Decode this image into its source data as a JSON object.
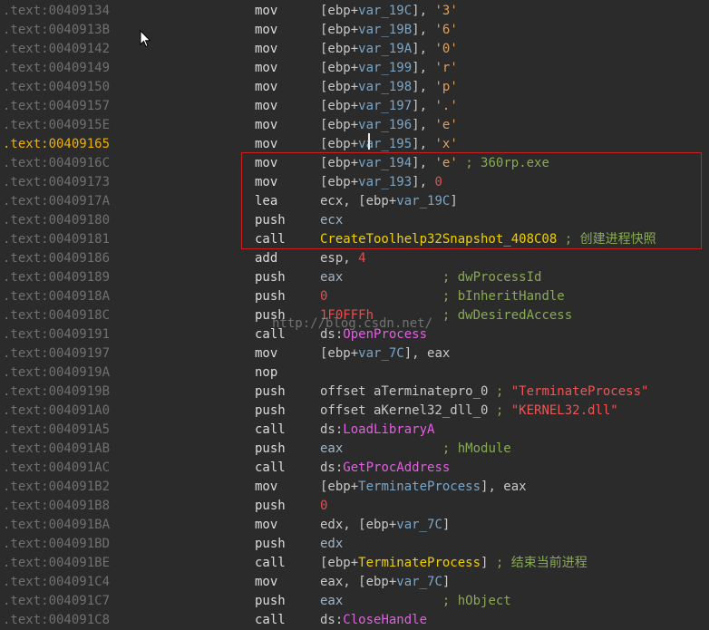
{
  "listing": {
    "rows": [
      {
        "addr": ".text:00409134",
        "hl": false,
        "mnem": "mov",
        "ops": [
          {
            "t": "[ebp+",
            "k": "plain"
          },
          {
            "t": "var_19C",
            "k": "var"
          },
          {
            "t": "], ",
            "k": "plain"
          },
          {
            "t": "'3'",
            "k": "str"
          }
        ]
      },
      {
        "addr": ".text:0040913B",
        "hl": false,
        "mnem": "mov",
        "ops": [
          {
            "t": "[ebp+",
            "k": "plain"
          },
          {
            "t": "var_19B",
            "k": "var"
          },
          {
            "t": "], ",
            "k": "plain"
          },
          {
            "t": "'6'",
            "k": "str"
          }
        ]
      },
      {
        "addr": ".text:00409142",
        "hl": false,
        "mnem": "mov",
        "ops": [
          {
            "t": "[ebp+",
            "k": "plain"
          },
          {
            "t": "var_19A",
            "k": "var"
          },
          {
            "t": "], ",
            "k": "plain"
          },
          {
            "t": "'0'",
            "k": "str"
          }
        ]
      },
      {
        "addr": ".text:00409149",
        "hl": false,
        "mnem": "mov",
        "ops": [
          {
            "t": "[ebp+",
            "k": "plain"
          },
          {
            "t": "var_199",
            "k": "var"
          },
          {
            "t": "], ",
            "k": "plain"
          },
          {
            "t": "'r'",
            "k": "str"
          }
        ]
      },
      {
        "addr": ".text:00409150",
        "hl": false,
        "mnem": "mov",
        "ops": [
          {
            "t": "[ebp+",
            "k": "plain"
          },
          {
            "t": "var_198",
            "k": "var"
          },
          {
            "t": "], ",
            "k": "plain"
          },
          {
            "t": "'p'",
            "k": "str"
          }
        ]
      },
      {
        "addr": ".text:00409157",
        "hl": false,
        "mnem": "mov",
        "ops": [
          {
            "t": "[ebp+",
            "k": "plain"
          },
          {
            "t": "var_197",
            "k": "var"
          },
          {
            "t": "], ",
            "k": "plain"
          },
          {
            "t": "'.'",
            "k": "str"
          }
        ]
      },
      {
        "addr": ".text:0040915E",
        "hl": false,
        "mnem": "mov",
        "ops": [
          {
            "t": "[ebp+",
            "k": "plain"
          },
          {
            "t": "var_196",
            "k": "var"
          },
          {
            "t": "], ",
            "k": "plain"
          },
          {
            "t": "'e'",
            "k": "str"
          }
        ]
      },
      {
        "addr": ".text:00409165",
        "hl": true,
        "mnem": "mov",
        "ops": [
          {
            "t": "[ebp+",
            "k": "plain"
          },
          {
            "t": "var_195",
            "k": "var"
          },
          {
            "t": "], ",
            "k": "plain"
          },
          {
            "t": "'x'",
            "k": "str"
          }
        ]
      },
      {
        "addr": ".text:0040916C",
        "hl": false,
        "mnem": "mov",
        "ops": [
          {
            "t": "[ebp+",
            "k": "plain"
          },
          {
            "t": "var_194",
            "k": "var"
          },
          {
            "t": "], ",
            "k": "plain"
          },
          {
            "t": "'e'",
            "k": "str"
          },
          {
            "t": " ; 360rp.exe",
            "k": "cmt"
          }
        ]
      },
      {
        "addr": ".text:00409173",
        "hl": false,
        "mnem": "mov",
        "ops": [
          {
            "t": "[ebp+",
            "k": "plain"
          },
          {
            "t": "var_193",
            "k": "var"
          },
          {
            "t": "], ",
            "k": "plain"
          },
          {
            "t": "0",
            "k": "num"
          }
        ]
      },
      {
        "addr": ".text:0040917A",
        "hl": false,
        "mnem": "lea",
        "ops": [
          {
            "t": "ecx, [ebp+",
            "k": "plain"
          },
          {
            "t": "var_19C",
            "k": "var"
          },
          {
            "t": "]",
            "k": "plain"
          }
        ]
      },
      {
        "addr": ".text:00409180",
        "hl": false,
        "mnem": "push",
        "ops": [
          {
            "t": "ecx",
            "k": "reg"
          }
        ]
      },
      {
        "addr": ".text:00409181",
        "hl": false,
        "mnem": "call",
        "ops": [
          {
            "t": "CreateToolhelp32Snapshot_408C08",
            "k": "func"
          },
          {
            "t": " ; 创建进程快照",
            "k": "cmt"
          }
        ]
      },
      {
        "addr": ".text:00409186",
        "hl": false,
        "mnem": "add",
        "ops": [
          {
            "t": "esp, ",
            "k": "plain"
          },
          {
            "t": "4",
            "k": "num"
          }
        ]
      },
      {
        "addr": ".text:00409189",
        "hl": false,
        "mnem": "push",
        "ops": [
          {
            "t": "eax",
            "k": "reg"
          },
          {
            "t": "             ; dwProcessId",
            "k": "cmt"
          }
        ]
      },
      {
        "addr": ".text:0040918A",
        "hl": false,
        "mnem": "push",
        "ops": [
          {
            "t": "0",
            "k": "num"
          },
          {
            "t": "               ; bInheritHandle",
            "k": "cmt"
          }
        ]
      },
      {
        "addr": ".text:0040918C",
        "hl": false,
        "mnem": "push",
        "ops": [
          {
            "t": "1F0FFFh",
            "k": "num"
          },
          {
            "t": "         ; dwDesiredAccess",
            "k": "cmt"
          }
        ]
      },
      {
        "addr": ".text:00409191",
        "hl": false,
        "mnem": "call",
        "ops": [
          {
            "t": "ds:",
            "k": "plain"
          },
          {
            "t": "OpenProcess",
            "k": "api"
          }
        ]
      },
      {
        "addr": ".text:00409197",
        "hl": false,
        "mnem": "mov",
        "ops": [
          {
            "t": "[ebp+",
            "k": "plain"
          },
          {
            "t": "var_7C",
            "k": "var"
          },
          {
            "t": "], eax",
            "k": "plain"
          }
        ]
      },
      {
        "addr": ".text:0040919A",
        "hl": false,
        "mnem": "nop",
        "ops": []
      },
      {
        "addr": ".text:0040919B",
        "hl": false,
        "mnem": "push",
        "ops": [
          {
            "t": "offset aTerminatepro_0",
            "k": "plain"
          },
          {
            "t": " ; ",
            "k": "cmt"
          },
          {
            "t": "\"TerminateProcess\"",
            "k": "cstr"
          }
        ]
      },
      {
        "addr": ".text:004091A0",
        "hl": false,
        "mnem": "push",
        "ops": [
          {
            "t": "offset aKernel32_dll_0",
            "k": "plain"
          },
          {
            "t": " ; ",
            "k": "cmt"
          },
          {
            "t": "\"KERNEL32.dll\"",
            "k": "cstr"
          }
        ]
      },
      {
        "addr": ".text:004091A5",
        "hl": false,
        "mnem": "call",
        "ops": [
          {
            "t": "ds:",
            "k": "plain"
          },
          {
            "t": "LoadLibraryA",
            "k": "api"
          }
        ]
      },
      {
        "addr": ".text:004091AB",
        "hl": false,
        "mnem": "push",
        "ops": [
          {
            "t": "eax",
            "k": "reg"
          },
          {
            "t": "             ; hModule",
            "k": "cmt"
          }
        ]
      },
      {
        "addr": ".text:004091AC",
        "hl": false,
        "mnem": "call",
        "ops": [
          {
            "t": "ds:",
            "k": "plain"
          },
          {
            "t": "GetProcAddress",
            "k": "api"
          }
        ]
      },
      {
        "addr": ".text:004091B2",
        "hl": false,
        "mnem": "mov",
        "ops": [
          {
            "t": "[ebp+",
            "k": "plain"
          },
          {
            "t": "TerminateProcess",
            "k": "var"
          },
          {
            "t": "], eax",
            "k": "plain"
          }
        ]
      },
      {
        "addr": ".text:004091B8",
        "hl": false,
        "mnem": "push",
        "ops": [
          {
            "t": "0",
            "k": "num"
          }
        ]
      },
      {
        "addr": ".text:004091BA",
        "hl": false,
        "mnem": "mov",
        "ops": [
          {
            "t": "edx, [ebp+",
            "k": "plain"
          },
          {
            "t": "var_7C",
            "k": "var"
          },
          {
            "t": "]",
            "k": "plain"
          }
        ]
      },
      {
        "addr": ".text:004091BD",
        "hl": false,
        "mnem": "push",
        "ops": [
          {
            "t": "edx",
            "k": "reg"
          }
        ]
      },
      {
        "addr": ".text:004091BE",
        "hl": false,
        "mnem": "call",
        "ops": [
          {
            "t": "[ebp+",
            "k": "plain"
          },
          {
            "t": "TerminateProcess",
            "k": "func"
          },
          {
            "t": "]",
            "k": "plain"
          },
          {
            "t": " ; 结束当前进程",
            "k": "cmt"
          }
        ]
      },
      {
        "addr": ".text:004091C4",
        "hl": false,
        "mnem": "mov",
        "ops": [
          {
            "t": "eax, [ebp+",
            "k": "plain"
          },
          {
            "t": "var_7C",
            "k": "var"
          },
          {
            "t": "]",
            "k": "plain"
          }
        ]
      },
      {
        "addr": ".text:004091C7",
        "hl": false,
        "mnem": "push",
        "ops": [
          {
            "t": "eax",
            "k": "reg"
          },
          {
            "t": "             ; hObject",
            "k": "cmt"
          }
        ]
      },
      {
        "addr": ".text:004091C8",
        "hl": false,
        "mnem": "call",
        "ops": [
          {
            "t": "ds:",
            "k": "plain"
          },
          {
            "t": "CloseHandle",
            "k": "api"
          }
        ]
      }
    ]
  },
  "watermark": "http://blog.csdn.net/",
  "colors": {
    "background": "#2b2b2b",
    "highlight_box": "#c8201e",
    "address": "#707070",
    "address_current": "#f0b000",
    "api": "#e060e0",
    "function": "#f0d000",
    "comment": "#88aa55",
    "number": "#e05050"
  }
}
